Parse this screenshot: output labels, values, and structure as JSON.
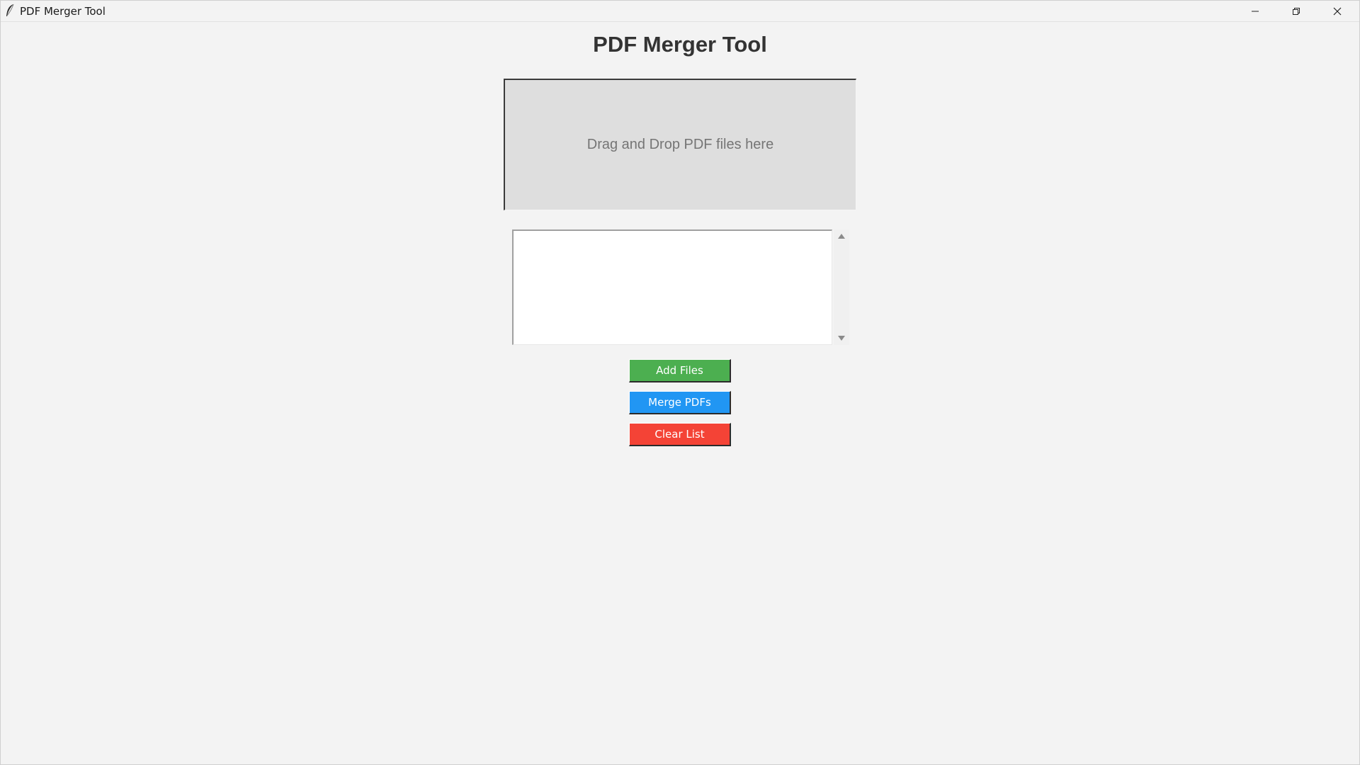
{
  "window": {
    "title": "PDF Merger Tool",
    "app_icon": "feather-icon",
    "controls": {
      "minimize_icon": "minimize-icon",
      "maximize_icon": "restore-icon",
      "close_icon": "close-icon"
    }
  },
  "main": {
    "heading": "PDF Merger Tool",
    "drop_zone": {
      "label": "Drag and Drop PDF files here"
    },
    "file_list": {
      "items": []
    },
    "buttons": {
      "add": {
        "label": "Add Files",
        "color": "#4caf50"
      },
      "merge": {
        "label": "Merge PDFs",
        "color": "#2196f3"
      },
      "clear": {
        "label": "Clear List",
        "color": "#f44336"
      }
    }
  }
}
